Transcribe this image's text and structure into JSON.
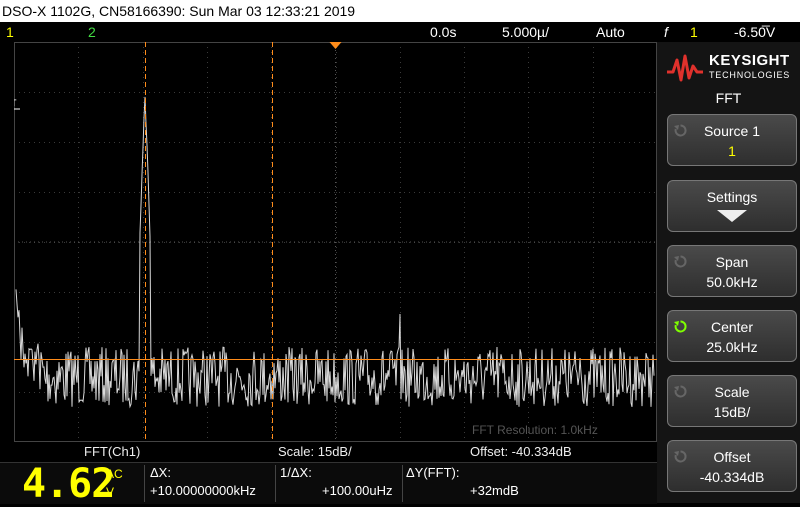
{
  "title_bar": "DSO-X 1102G, CN58166390: Sun Mar 03 12:33:21 2019",
  "status": {
    "ch1": "1",
    "ch2": "2",
    "time_offset": "0.0s",
    "timebase": "5.000µ/",
    "trigger_mode": "Auto",
    "trigger_icon": "f",
    "trigger_channel": "1",
    "trigger_level": "-6.50̅V"
  },
  "screen": {
    "fft_marker": "FFT",
    "watermark": "FFT Resolution: 1.0kHz"
  },
  "bottom_info": {
    "label": "FFT(Ch1)",
    "scale": "Scale: 15dB/",
    "offset": "Offset: -40.334dB"
  },
  "measurement": {
    "value": "4.62",
    "coupling": "AC",
    "unit": "V",
    "dx_label": "ΔX:",
    "dx_value": "+10.00000000kHz",
    "inv_dx_label": "1/ΔX:",
    "inv_dx_value": "+100.00uHz",
    "dy_label": "ΔY(FFT):",
    "dy_value": "+32mdB"
  },
  "brand": {
    "name": "KEYSIGHT",
    "sub": "TECHNOLOGIES",
    "accent": "#e0312c"
  },
  "panel": {
    "title": "FFT",
    "softkeys": [
      {
        "l1": "Source 1",
        "l2": "1",
        "knob": "inactive"
      },
      {
        "l1": "Settings",
        "l2": "",
        "knob": "none"
      },
      {
        "l1": "Span",
        "l2": "50.0kHz",
        "knob": "inactive"
      },
      {
        "l1": "Center",
        "l2": "25.0kHz",
        "knob": "active"
      },
      {
        "l1": "Scale",
        "l2": "15dB/",
        "knob": "inactive"
      },
      {
        "l1": "Offset",
        "l2": "-40.334dB",
        "knob": "inactive"
      }
    ]
  },
  "colors": {
    "trace": "#d8d8d8",
    "cursor": "#ff8c1a",
    "grid": "#3a3a3a",
    "ch1": "#ffff00",
    "ch2": "#44dd44",
    "active_knob": "#7fff00"
  }
}
